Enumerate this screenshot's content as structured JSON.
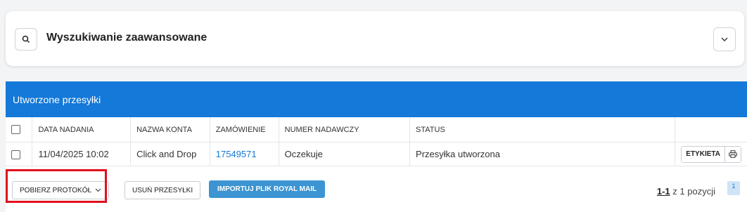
{
  "search": {
    "title": "Wyszukiwanie zaawansowane",
    "search_icon": "search-icon",
    "expand_icon": "chevron-down-icon"
  },
  "panel": {
    "title": "Utworzone przesyłki",
    "header_color": "#1479d8"
  },
  "table": {
    "columns": [
      "DATA NADANIA",
      "NAZWA KONTA",
      "ZAMÓWIENIE",
      "NUMER NADAWCZY",
      "STATUS"
    ],
    "rows": [
      {
        "date": "11/04/2025 10:02",
        "account": "Click and Drop",
        "order": "17549571",
        "tracking": "Oczekuje",
        "status": "Przesyłka utworzona",
        "label_button": "ETYKIETA"
      }
    ]
  },
  "footer": {
    "download_protocol": "POBIERZ PROTOKÓŁ",
    "delete_shipments": "USUŃ PRZESYŁKI",
    "import_file": "IMPORTUJ PLIK ROYAL MAIL",
    "pager_range": "1-1",
    "pager_suffix": "z 1 pozycji",
    "current_page": "1",
    "highlight_color": "#e0101e"
  }
}
